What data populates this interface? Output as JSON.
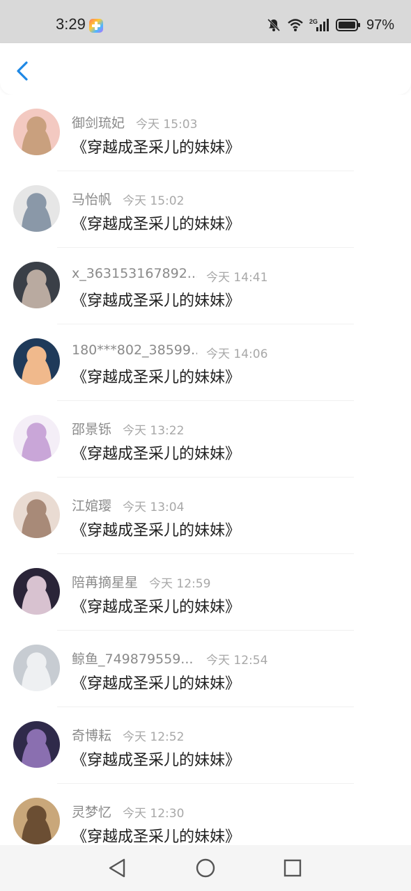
{
  "status": {
    "time": "3:29",
    "battery_pct": "97%",
    "network": "2G",
    "icons": [
      "app-notification-icon",
      "bell-muted-icon",
      "wifi-icon",
      "signal-icon",
      "battery-icon"
    ]
  },
  "header": {
    "back_icon": "chevron-left-icon",
    "accent": "#1e88e5"
  },
  "items": [
    {
      "name": "御剑琉妃",
      "time": "今天 15:03",
      "title": "《穿越成圣采儿的妹妹》",
      "avatar_colors": [
        "#f3c9c1",
        "#c9a07e"
      ]
    },
    {
      "name": "马怡帆",
      "time": "今天 15:02",
      "title": "《穿越成圣采儿的妹妹》",
      "avatar_colors": [
        "#e6e6e6",
        "#8a98a8"
      ]
    },
    {
      "name": "x_363153167892...",
      "time": "今天 14:41",
      "title": "《穿越成圣采儿的妹妹》",
      "avatar_colors": [
        "#3a3f47",
        "#b9aaa0"
      ]
    },
    {
      "name": "180***802_38599...",
      "time": "今天 14:06",
      "title": "《穿越成圣采儿的妹妹》",
      "avatar_colors": [
        "#1f3a5a",
        "#f0b98c"
      ]
    },
    {
      "name": "邵景铄",
      "time": "今天 13:22",
      "title": "《穿越成圣采儿的妹妹》",
      "avatar_colors": [
        "#f4eef7",
        "#c9a6d8"
      ]
    },
    {
      "name": "江婠璎",
      "time": "今天 13:04",
      "title": "《穿越成圣采儿的妹妹》",
      "avatar_colors": [
        "#e9dbd2",
        "#a88a78"
      ]
    },
    {
      "name": "陪苒摘星星",
      "time": "今天 12:59",
      "title": "《穿越成圣采儿的妹妹》",
      "avatar_colors": [
        "#2a2438",
        "#d8c2d0"
      ]
    },
    {
      "name": "鲸鱼_749879559...",
      "time": "今天 12:54",
      "title": "《穿越成圣采儿的妹妹》",
      "avatar_colors": [
        "#c7ccd2",
        "#eef0f2"
      ]
    },
    {
      "name": "奇博耘",
      "time": "今天 12:52",
      "title": "《穿越成圣采儿的妹妹》",
      "avatar_colors": [
        "#2f2a4a",
        "#8a6fb0"
      ]
    },
    {
      "name": "灵梦忆",
      "time": "今天 12:30",
      "title": "《穿越成圣采儿的妹妹》",
      "avatar_colors": [
        "#c9a77a",
        "#6b4e33"
      ]
    }
  ],
  "nav": {
    "icons": [
      "back-triangle-icon",
      "home-circle-icon",
      "recents-square-icon"
    ]
  }
}
